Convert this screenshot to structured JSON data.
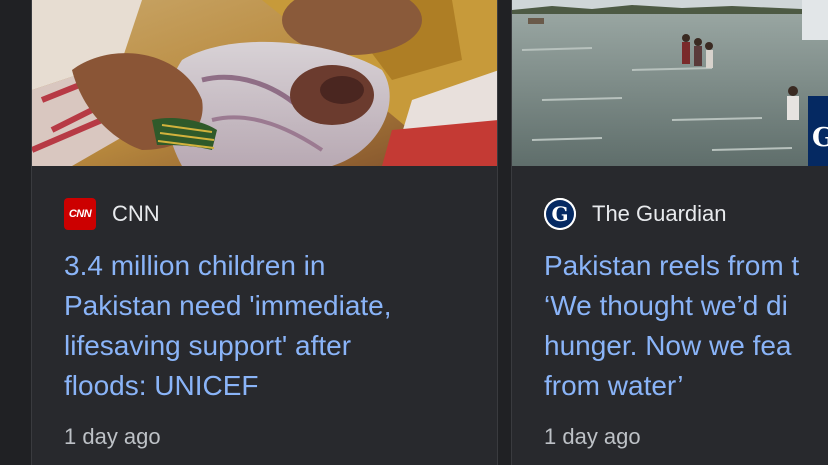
{
  "cards": [
    {
      "source": "CNN",
      "logo_icon": "cnn-logo-icon",
      "logo_text": "CNN",
      "headline_lines": [
        "3.4 million children in",
        "Pakistan need 'immediate,",
        "lifesaving support' after",
        "floods: UNICEF"
      ],
      "time": "1 day ago",
      "image_icon": "news-photo-mother-and-baby"
    },
    {
      "source": "The Guardian",
      "logo_icon": "guardian-logo-icon",
      "logo_text": "G",
      "headline_lines": [
        "Pakistan reels from t",
        "‘We thought we’d di",
        "hunger. Now we fea",
        "from water’"
      ],
      "time": "1 day ago",
      "image_icon": "news-photo-flooded-field"
    }
  ],
  "colors": {
    "background": "#202124",
    "card": "#28292d",
    "headline": "#8ab4f8",
    "source": "#e8eaed",
    "time": "#bdc1c6",
    "cnn_red": "#cc0000"
  }
}
